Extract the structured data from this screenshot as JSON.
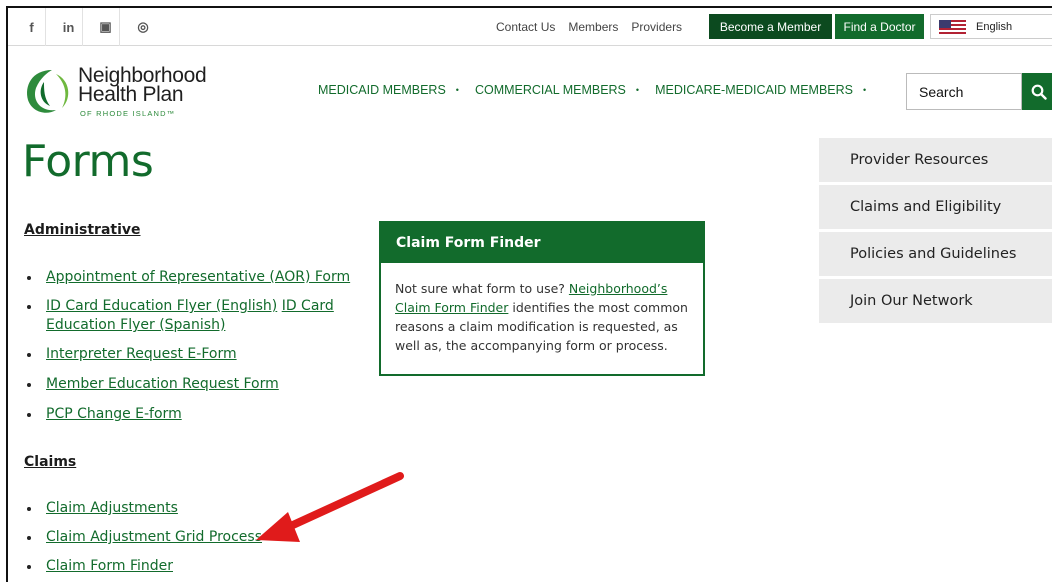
{
  "social": {
    "icons": [
      "facebook-icon",
      "linkedin-icon",
      "youtube-icon",
      "instagram-icon"
    ],
    "glyphs": [
      "f",
      "in",
      "▣",
      "◎"
    ]
  },
  "utility": {
    "contact": "Contact Us",
    "members": "Members",
    "providers": "Providers",
    "become_member": "Become a Member",
    "find_doctor": "Find a Doctor",
    "language": "English"
  },
  "logo": {
    "line1": "Neighborhood",
    "line2": "Health Plan",
    "sub": "OF RHODE ISLAND™"
  },
  "nav": {
    "items": [
      "MEDICAID MEMBERS",
      "COMMERCIAL MEMBERS",
      "MEDICARE-MEDICAID MEMBERS"
    ]
  },
  "search": {
    "label": "Search"
  },
  "page": {
    "title": "Forms"
  },
  "administrative": {
    "heading": "Administrative",
    "items": [
      "Appointment of Representative (AOR) Form",
      "ID Card Education Flyer (English)",
      "ID Card",
      "Education Flyer (Spanish)",
      "Interpreter Request E-Form",
      "Member Education Request Form",
      "PCP Change E-form"
    ]
  },
  "claims": {
    "heading": "Claims",
    "items": [
      "Claim Adjustments",
      "Claim Adjustment Grid Process",
      "Claim Form Finder"
    ]
  },
  "finder": {
    "title": "Claim Form Finder",
    "text_before": "Not sure what form to use? ",
    "link1": "Neighborhood’s",
    "link2": "Claim Form Finder",
    "text_after": " identifies the most common reasons a claim modification is requested, as well as, the accompanying form or process."
  },
  "sidebar": {
    "items": [
      "Provider Resources",
      "Claims and Eligibility",
      "Policies and Guidelines",
      "Join Our Network"
    ]
  },
  "colors": {
    "brand_green": "#126b2c",
    "dark_green": "#0c4a1f",
    "sidebar_bg": "#ebebeb",
    "arrow_red": "#e01b1b"
  }
}
